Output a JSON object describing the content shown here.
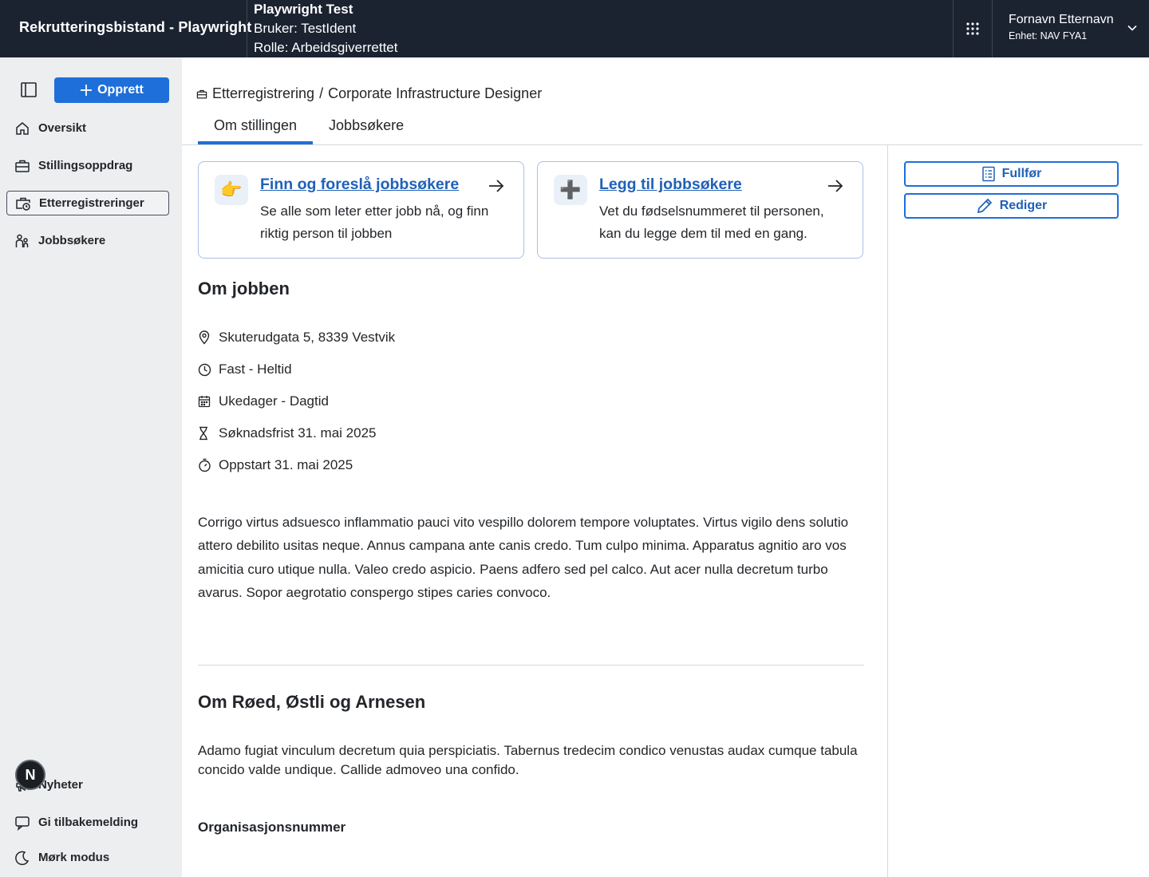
{
  "header": {
    "app_title": "Rekrutteringsbistand - Playwright",
    "test_title": "Playwright Test",
    "test_user": "Bruker: TestIdent",
    "test_role": "Rolle: Arbeidsgiverrettet",
    "user_name": "Fornavn Etternavn",
    "user_unit": "Enhet: NAV FYA1",
    "apps_icon": "grid-icon"
  },
  "sidebar": {
    "create_label": "Opprett",
    "items": [
      {
        "label": "Oversikt",
        "icon": "house-icon"
      },
      {
        "label": "Stillingsoppdrag",
        "icon": "briefcase-icon"
      },
      {
        "label": "Etterregistreringer",
        "icon": "briefcase-clock-icon",
        "active": true
      },
      {
        "label": "Jobbsøkere",
        "icon": "people-icon"
      }
    ],
    "bottom_items": [
      {
        "label": "Nyheter",
        "icon": "megaphone-icon"
      },
      {
        "label": "Gi tilbakemelding",
        "icon": "chat-icon"
      },
      {
        "label": "Mørk modus",
        "icon": "moon-icon"
      }
    ],
    "avatar_letter": "N"
  },
  "breadcrumb": {
    "section": "Etterregistrering",
    "separator": "/",
    "title": "Corporate Infrastructure Designer"
  },
  "tabs": [
    {
      "label": "Om stillingen",
      "active": true
    },
    {
      "label": "Jobbsøkere",
      "active": false
    }
  ],
  "cards": [
    {
      "emoji": "👉",
      "title": "Finn og foreslå jobbsøkere",
      "description": "Se alle som leter etter jobb nå, og finn riktig person til jobben"
    },
    {
      "emoji": "➕",
      "title": "Legg til jobbsøkere",
      "description": "Vet du fødselsnummeret til personen, kan du legge dem til med en gang."
    }
  ],
  "actions": {
    "complete_label": "Fullfør",
    "edit_label": "Rediger"
  },
  "job": {
    "heading": "Om jobben",
    "facts": [
      {
        "icon": "location-pin-icon",
        "text": "Skuterudgata 5, 8339 Vestvik"
      },
      {
        "icon": "clock-icon",
        "text": "Fast - Heltid"
      },
      {
        "icon": "calendar-icon",
        "text": "Ukedager - Dagtid"
      },
      {
        "icon": "hourglass-icon",
        "text": "Søknadsfrist 31. mai 2025"
      },
      {
        "icon": "stopwatch-icon",
        "text": "Oppstart 31. mai 2025"
      }
    ],
    "description": "Corrigo virtus adsuesco inflammatio pauci vito vespillo dolorem tempore voluptates. Virtus vigilo dens solutio attero debilito usitas neque. Annus campana ante canis credo. Tum culpo minima. Apparatus agnitio aro vos amicitia curo utique nulla. Valeo credo aspicio. Paens adfero sed pel calco. Aut acer nulla decretum turbo avarus. Sopor aegrotatio conspergo stipes caries convoco."
  },
  "employer": {
    "heading": "Om Røed, Østli og Arnesen",
    "description": "Adamo fugiat vinculum decretum quia perspiciatis. Tabernus tredecim condico venustas audax cumque tabula concido valde undique. Callide admoveo una confido.",
    "org_label": "Organisasjonsnummer"
  },
  "colors": {
    "topbar": "#1b2331",
    "sidebar": "#eceef0",
    "accent": "#1e6fd9",
    "link": "#1f61b8"
  }
}
